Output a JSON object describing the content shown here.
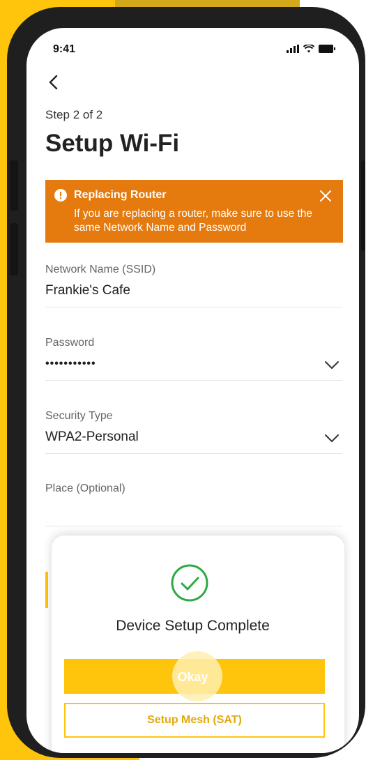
{
  "status": {
    "time": "9:41"
  },
  "header": {
    "step": "Step 2 of 2",
    "title": "Setup Wi-Fi"
  },
  "banner": {
    "title": "Replacing Router",
    "text": "If you are replacing a router, make sure to use the same Network Name and Password"
  },
  "fields": {
    "ssid": {
      "label": "Network Name (SSID)",
      "value": "Frankie's Cafe"
    },
    "password": {
      "label": "Password",
      "value": "•••••••••••"
    },
    "security": {
      "label": "Security Type",
      "value": "WPA2-Personal"
    },
    "place": {
      "label": "Place (Optional)",
      "value": ""
    }
  },
  "dialog": {
    "message": "Device Setup Complete",
    "okay_label": "Okay",
    "mesh_label": "Setup Mesh (SAT)"
  },
  "colors": {
    "accent": "#FFC40C",
    "banner": "#E57A0E",
    "success": "#2DAA43"
  },
  "icons": [
    "back-arrow-icon",
    "info-icon",
    "close-icon",
    "chevron-down-icon",
    "checkmark-circle-icon",
    "signal-icon",
    "wifi-icon",
    "battery-icon"
  ]
}
